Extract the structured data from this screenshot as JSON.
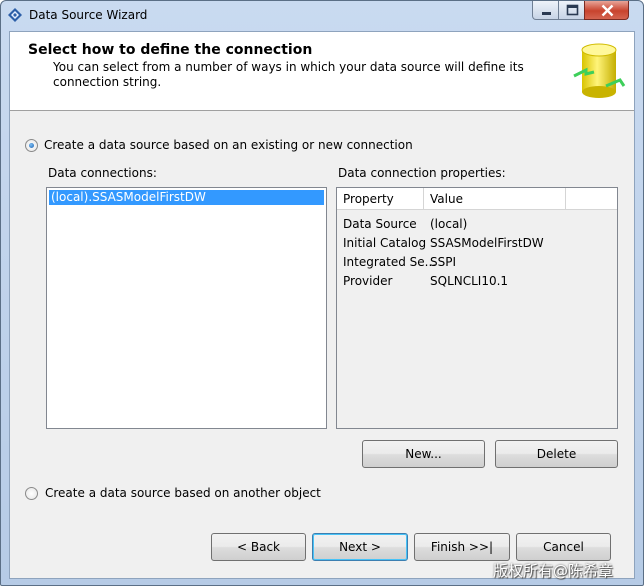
{
  "window": {
    "title": "Data Source Wizard"
  },
  "header": {
    "title": "Select how to define the connection",
    "subtitle": "You can select from a number of ways in which your data source will define its connection string."
  },
  "options": {
    "existing_connection": {
      "label": "Create a data source based on an existing or new connection",
      "selected": true
    },
    "another_object": {
      "label": "Create a data source based on another object",
      "selected": false
    }
  },
  "data_connections": {
    "label": "Data connections:",
    "items": [
      "(local).SSASModelFirstDW"
    ],
    "selected_index": 0
  },
  "connection_properties": {
    "label": "Data connection properties:",
    "columns": [
      "Property",
      "Value"
    ],
    "rows": [
      {
        "property": "Data Source",
        "value": "(local)"
      },
      {
        "property": "Initial Catalog",
        "value": "SSASModelFirstDW"
      },
      {
        "property": "Integrated Se...",
        "value": "SSPI"
      },
      {
        "property": "Provider",
        "value": "SQLNCLI10.1"
      }
    ]
  },
  "buttons": {
    "new": "New...",
    "delete": "Delete",
    "back": "< Back",
    "next": "Next >",
    "finish": "Finish >>|",
    "cancel": "Cancel"
  },
  "watermark": "版权所有@陈希章",
  "colors": {
    "selection": "#3399ff",
    "radio_selected": "#1b5fb0",
    "window_frame": "#b6cbe6"
  }
}
